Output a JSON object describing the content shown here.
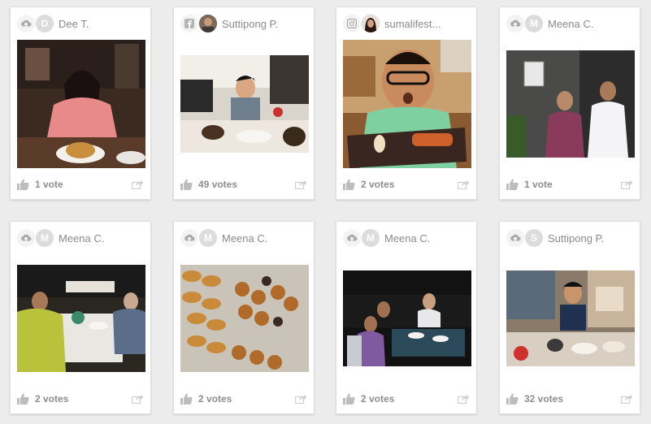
{
  "colors": {
    "background": "#ececec",
    "card": "#ffffff",
    "muted_text": "#8b8b8b",
    "icon": "#bdbdbd"
  },
  "cards": [
    {
      "source_icon": "cloud-icon",
      "avatar": "D",
      "author": "Dee T.",
      "votes": "1 vote"
    },
    {
      "source_icon": "facebook-icon",
      "avatar": "",
      "author": "Suttipong P.",
      "votes": "49 votes"
    },
    {
      "source_icon": "instagram-icon",
      "avatar": "",
      "author": "sumalifest...",
      "votes": "2 votes"
    },
    {
      "source_icon": "cloud-icon",
      "avatar": "M",
      "author": "Meena C.",
      "votes": "1 vote"
    },
    {
      "source_icon": "cloud-icon",
      "avatar": "M",
      "author": "Meena C.",
      "votes": "2 votes"
    },
    {
      "source_icon": "cloud-icon",
      "avatar": "M",
      "author": "Meena C.",
      "votes": "2 votes"
    },
    {
      "source_icon": "cloud-icon",
      "avatar": "M",
      "author": "Meena C.",
      "votes": "2 votes"
    },
    {
      "source_icon": "cloud-icon",
      "avatar": "S",
      "author": "Suttipong P.",
      "votes": "32 votes"
    }
  ]
}
